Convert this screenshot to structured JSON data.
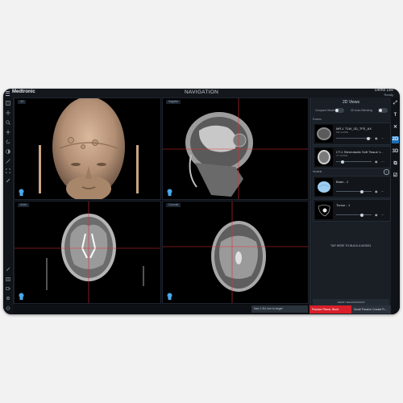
{
  "app": {
    "brand": "Medtronic",
    "title": "NAVIGATION",
    "user_name": "Demo Lee",
    "user_role": "Ready"
  },
  "viewports": [
    {
      "label": "3D"
    },
    {
      "label": "Sagittal"
    },
    {
      "label": "Axial"
    },
    {
      "label": "Coronal"
    }
  ],
  "panel": {
    "title": "2D Views",
    "compare_mode_label": "Compare Mode",
    "auto_blending_label": "2D Auto Blending",
    "exams_label": "Exams",
    "models_label": "Models",
    "exams": [
      {
        "name": "MR-1 T1W_3D_TFE_AX",
        "meta": "MR GUIDE"
      },
      {
        "name": "CT-1 Stereotactic Soft Tissue 1...",
        "meta": "CT GUIDE"
      }
    ],
    "models": [
      {
        "name": "Brain - 1"
      },
      {
        "name": "Tumor - 1"
      }
    ],
    "build_model": "TAP HERE TO BUILD A MODEL",
    "verify": "VERIFY REGISTRATION"
  },
  "right_icons": [
    "T",
    "2D",
    "3D"
  ],
  "status": {
    "message": "Max 1.5U mm to target"
  },
  "bottom_tabs": {
    "instrument_red": "Passive Planar, Blunt",
    "instrument_gray": "Small Passive Cranial Fr..."
  },
  "colors": {
    "accent_blue": "#1d6fb6",
    "instrument_red": "#d81f2a",
    "crosshair_red": "#e0303a"
  }
}
